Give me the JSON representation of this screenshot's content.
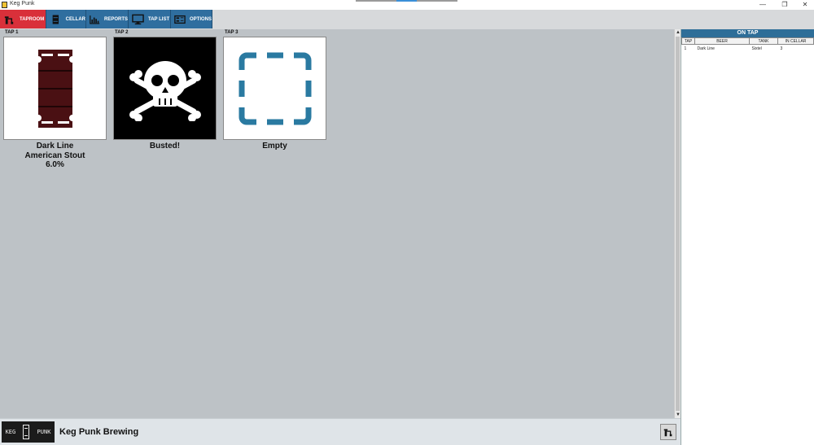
{
  "window": {
    "title": "Keg Punk",
    "min": "—",
    "max": "❐",
    "close": "✕"
  },
  "toolbar": {
    "items": [
      {
        "label": "TAPROOM",
        "icon": "keg-tap-icon",
        "active": true
      },
      {
        "label": "CELLAR",
        "icon": "keg-icon",
        "active": false
      },
      {
        "label": "REPORTS",
        "icon": "bar-chart-icon",
        "active": false
      },
      {
        "label": "TAP LIST",
        "icon": "monitor-icon",
        "active": false
      },
      {
        "label": "OPTIONS",
        "icon": "options-icon",
        "active": false
      }
    ]
  },
  "taps": [
    {
      "label": "TAP 1",
      "icon": "keg-icon",
      "name": "Dark Line",
      "style": "American Stout",
      "abv": "6.0%"
    },
    {
      "label": "TAP 2",
      "icon": "skull-crossbones-icon",
      "name": "Busted!"
    },
    {
      "label": "TAP 3",
      "icon": "empty-frame-icon",
      "name": "Empty"
    }
  ],
  "on_tap": {
    "title": "ON TAP",
    "columns": [
      "TAP",
      "BEER",
      "TANK",
      "IN CELLAR"
    ],
    "rows": [
      {
        "tap": "1",
        "beer": "Dark Line",
        "tank": "Sixtel",
        "in_cellar": "3"
      }
    ]
  },
  "footer": {
    "logo_left": "KEG",
    "logo_right": "PUNK",
    "brewery": "Keg Punk Brewing"
  },
  "colors": {
    "accent_red": "#d9303a",
    "nav_blue": "#2f6e9f",
    "panel_header": "#2e6e98",
    "main_bg": "#bdc2c6",
    "keg_color": "#4a1013",
    "empty_frame": "#2a7aa1"
  }
}
